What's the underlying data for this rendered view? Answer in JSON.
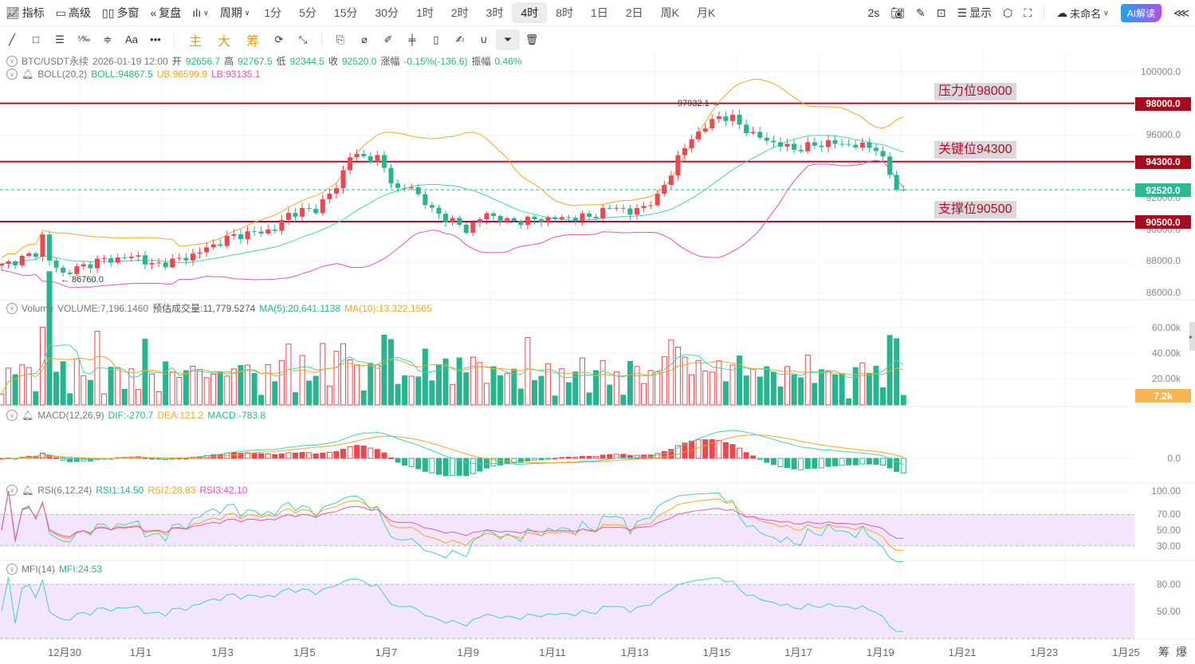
{
  "toolbar": {
    "indicators": "指标",
    "advanced": "高级",
    "multi_window": "多窗",
    "replay": "复盘",
    "period": "周期",
    "periods": [
      "1分",
      "5分",
      "15分",
      "30分",
      "1时",
      "2时",
      "3时",
      "4时",
      "8时",
      "1日",
      "2日",
      "周K",
      "月K"
    ],
    "active_period": "4时",
    "refresh": "2s",
    "display": "显示",
    "layout_name": "未命名",
    "ai_button": "AI解读"
  },
  "drawing_tools": {
    "text_tool": "Aa",
    "main": "主",
    "big": "大",
    "chips": "筹"
  },
  "symbol_info": {
    "symbol": "BTC/USDT永续",
    "time": "2026-01-19 12:00",
    "open_label": "开",
    "open": "92656.7",
    "high_label": "高",
    "high": "92767.5",
    "low_label": "低",
    "low": "92344.5",
    "close_label": "收",
    "close": "92520.0",
    "change_label": "涨幅",
    "change": "-0.15%(-136.6)",
    "amp_label": "振幅",
    "amplitude": "0.46%"
  },
  "boll": {
    "name": "BOLL(20,2)",
    "mid": "BOLL:94867.5",
    "ub": "UB:96599.9",
    "lb": "LB:93135.1"
  },
  "volume": {
    "name": "Volume",
    "vol": "VOLUME:7,196.1460",
    "est": "预估成交量:11,779.5274",
    "ma5": "MA(5):20,641.1138",
    "ma10": "MA(10):13,322.1565",
    "current_tag": "7.2k",
    "axis": [
      "60.00k",
      "40.00k",
      "20.00k"
    ]
  },
  "macd": {
    "name": "MACD(12,26,9)",
    "dif": "DIF:-270.7",
    "dea": "DEA:121.2",
    "macd": "MACD:-783.8",
    "axis": [
      "0.0"
    ]
  },
  "rsi": {
    "name": "RSI(6,12,24)",
    "rsi1": "RSI1:14.50",
    "rsi2": "RSI2:28.83",
    "rsi3": "RSI3:42.10",
    "axis": [
      "100.00",
      "70.00",
      "50.00",
      "30.00"
    ]
  },
  "mfi": {
    "name": "MFI(14)",
    "mfi": "MFI:24.53",
    "axis": [
      "80.00",
      "50.00"
    ]
  },
  "price_axis": [
    "100000.0",
    "96000.0",
    "92000.0",
    "90000.0",
    "88000.0",
    "86000.0"
  ],
  "levels": [
    {
      "note": "压力位98000",
      "tag": "98000.0",
      "price": 98000
    },
    {
      "note": "关键位94300",
      "tag": "94300.0",
      "price": 94300
    },
    {
      "note": "支撑位90500",
      "tag": "90500.0",
      "price": 90500
    }
  ],
  "current_price": {
    "tag": "92520.0",
    "price": 92520
  },
  "markers": {
    "high": "97932.1",
    "low": "86760.0"
  },
  "dates": [
    "12月30",
    "1月1",
    "1月3",
    "1月5",
    "1月7",
    "1月9",
    "1月11",
    "1月13",
    "1月15",
    "1月17",
    "1月19",
    "1月21",
    "1月23",
    "1月25"
  ],
  "bottom_right": [
    "筹",
    "爆"
  ],
  "colors": {
    "up": "#f0464f",
    "down": "#26b58e",
    "level": "#b0112a",
    "boll_mid": "#3fd4b4",
    "boll_ub": "#f5a623",
    "boll_lb": "#e84fbf"
  },
  "chart_data": {
    "type": "candlestick",
    "interval": "4h",
    "close_anchors": [
      [
        0,
        87700
      ],
      [
        5,
        88500
      ],
      [
        6,
        89600
      ],
      [
        7,
        88000
      ],
      [
        9,
        87200
      ],
      [
        14,
        88000
      ],
      [
        20,
        88300
      ],
      [
        22,
        87700
      ],
      [
        27,
        88200
      ],
      [
        31,
        89000
      ],
      [
        34,
        89600
      ],
      [
        40,
        90000
      ],
      [
        42,
        91000
      ],
      [
        46,
        91300
      ],
      [
        49,
        92700
      ],
      [
        51,
        94700
      ],
      [
        55,
        94500
      ],
      [
        58,
        92500
      ],
      [
        60,
        92700
      ],
      [
        63,
        91200
      ],
      [
        66,
        90500
      ],
      [
        68,
        90000
      ],
      [
        71,
        91000
      ],
      [
        74,
        90500
      ],
      [
        81,
        90700
      ],
      [
        86,
        90800
      ],
      [
        90,
        91500
      ],
      [
        92,
        91000
      ],
      [
        96,
        92000
      ],
      [
        99,
        94500
      ],
      [
        101,
        95800
      ],
      [
        105,
        97200
      ],
      [
        107,
        97000
      ],
      [
        110,
        96000
      ],
      [
        113,
        95500
      ],
      [
        116,
        95100
      ],
      [
        121,
        95500
      ],
      [
        128,
        95200
      ],
      [
        130,
        93500
      ],
      [
        131,
        92700
      ],
      [
        132,
        92520
      ]
    ]
  }
}
